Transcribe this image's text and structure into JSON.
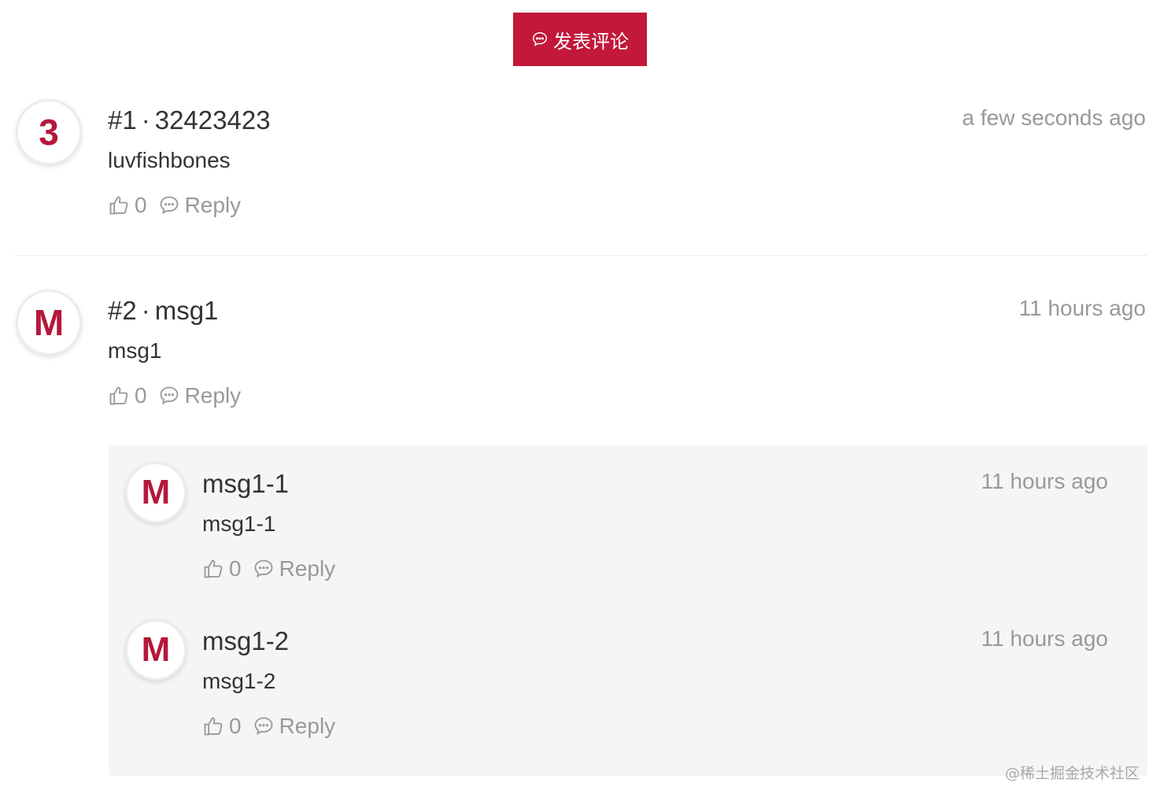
{
  "post_button": {
    "label": "发表评论",
    "icon": "chat-bubble-icon"
  },
  "colors": {
    "accent": "#c2183a",
    "avatar_text": "#b4183a",
    "muted": "#999999",
    "reply_bg": "#f5f5f5"
  },
  "comments": [
    {
      "avatar": "3",
      "index": "#1",
      "separator": "·",
      "author": "32423423",
      "content": "luvfishbones",
      "time": "a few seconds ago",
      "likes": "0",
      "reply_label": "Reply"
    },
    {
      "avatar": "M",
      "index": "#2",
      "separator": "·",
      "author": "msg1",
      "content": "msg1",
      "time": "11 hours ago",
      "likes": "0",
      "reply_label": "Reply",
      "replies": [
        {
          "avatar": "M",
          "author": "msg1-1",
          "content": "msg1-1",
          "time": "11 hours ago",
          "likes": "0",
          "reply_label": "Reply"
        },
        {
          "avatar": "M",
          "author": "msg1-2",
          "content": "msg1-2",
          "time": "11 hours ago",
          "likes": "0",
          "reply_label": "Reply"
        }
      ]
    }
  ],
  "watermark": "@稀土掘金技术社区"
}
